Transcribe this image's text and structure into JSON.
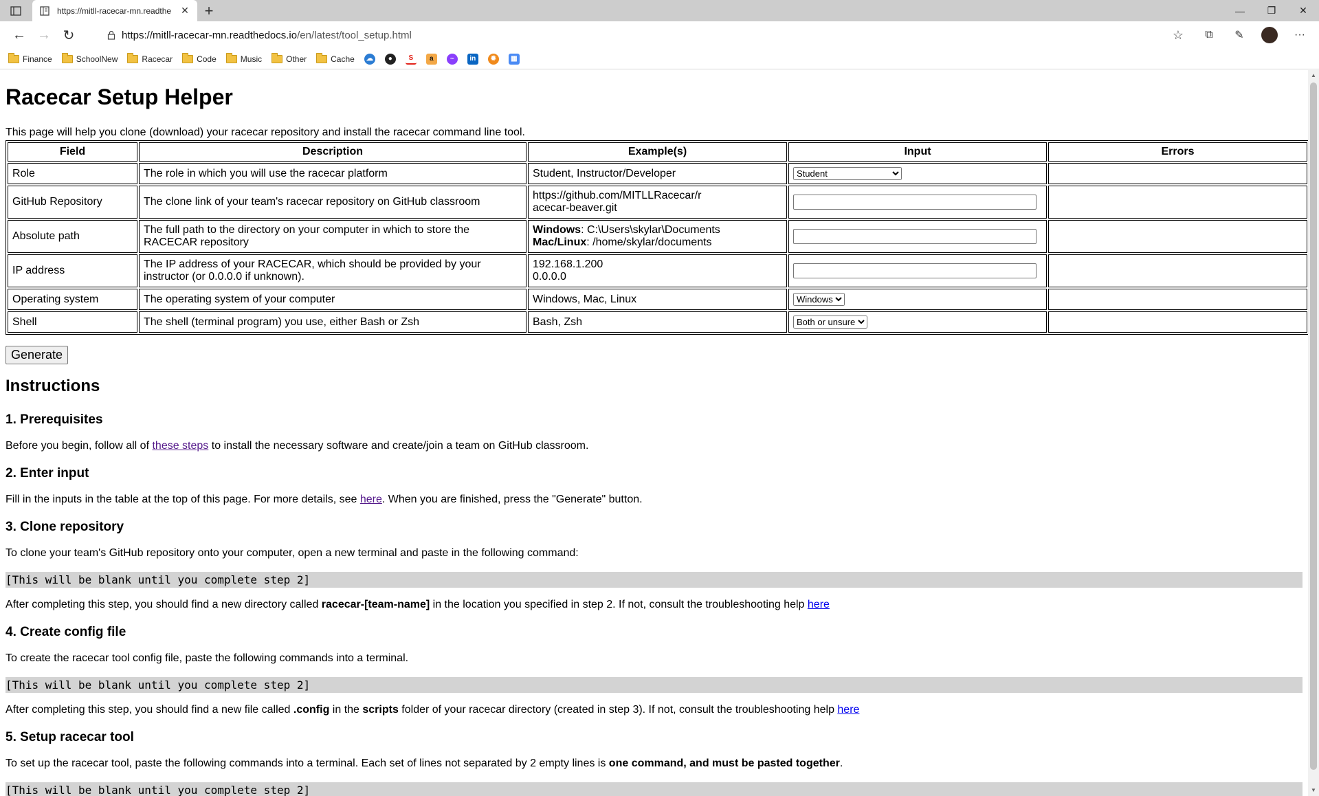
{
  "browser": {
    "tab_title": "https://mitll-racecar-mn.readthe",
    "url_host": "https://mitll-racecar-mn.readthedocs.io",
    "url_path": "/en/latest/tool_setup.html",
    "bookmarks": [
      "Finance",
      "SchoolNew",
      "Racecar",
      "Code",
      "Music",
      "Other",
      "Cache"
    ],
    "bookmark_icons": [
      "onedrive-icon",
      "github-icon",
      "stackoverflow-icon",
      "amazon-icon",
      "messenger-icon",
      "linkedin-icon",
      "sunburst-icon",
      "calendar-icon"
    ]
  },
  "page": {
    "title": "Racecar Setup Helper",
    "intro": "This page will help you clone (download) your racecar repository and install the racecar command line tool.",
    "table": {
      "headers": [
        "Field",
        "Description",
        "Example(s)",
        "Input",
        "Errors"
      ],
      "rows": [
        {
          "field": "Role",
          "description": "The role in which you will use the racecar platform",
          "example": "Student, Instructor/Developer",
          "input_type": "select",
          "selected": "Student"
        },
        {
          "field": "GitHub Repository",
          "description": "The clone link of your team's racecar repository on GitHub classroom",
          "example": "https://github.com/MITLLRacecar/racecar-beaver.git",
          "input_type": "text"
        },
        {
          "field": "Absolute path",
          "description": "The full path to the directory on your computer in which to store the RACECAR repository",
          "example_win_label": "Windows",
          "example_win": ": C:\\Users\\skylar\\Documents",
          "example_mac_label": "Mac/Linux",
          "example_mac": ": /home/skylar/documents",
          "input_type": "text"
        },
        {
          "field": "IP address",
          "description": "The IP address of your RACECAR, which should be provided by your instructor (or 0.0.0.0 if unknown).",
          "example_line1": "192.168.1.200",
          "example_line2": "0.0.0.0",
          "input_type": "text"
        },
        {
          "field": "Operating system",
          "description": "The operating system of your computer",
          "example": "Windows, Mac, Linux",
          "input_type": "select",
          "selected": "Windows"
        },
        {
          "field": "Shell",
          "description": "The shell (terminal program) you use, either Bash or Zsh",
          "example": "Bash, Zsh",
          "input_type": "select",
          "selected": "Both or unsure"
        }
      ]
    },
    "generate_label": "Generate",
    "instructions_title": "Instructions",
    "step1": {
      "title": "1. Prerequisites",
      "text_before": "Before you begin, follow all of ",
      "link": "these steps",
      "text_after": " to install the necessary software and create/join a team on GitHub classroom."
    },
    "step2": {
      "title": "2. Enter input",
      "text_before": "Fill in the inputs in the table at the top of this page. For more details, see ",
      "link": "here",
      "text_after": ". When you are finished, press the \"Generate\" button."
    },
    "step3": {
      "title": "3. Clone repository",
      "text": "To clone your team's GitHub repository onto your computer, open a new terminal and paste in the following command:",
      "code": "[This will be blank until you complete step 2]",
      "after_before": "After completing this step, you should find a new directory called ",
      "after_bold": "racecar-[team-name]",
      "after_mid": " in the location you specified in step 2. If not, consult the troubleshooting help ",
      "after_link": "here"
    },
    "step4": {
      "title": "4. Create config file",
      "text": "To create the racecar tool config file, paste the following commands into a terminal.",
      "code": "[This will be blank until you complete step 2]",
      "after_before": "After completing this step, you should find a new file called ",
      "after_bold1": ".config",
      "after_mid1": " in the ",
      "after_bold2": "scripts",
      "after_mid2": " folder of your racecar directory (created in step 3). If not, consult the troubleshooting help ",
      "after_link": "here"
    },
    "step5": {
      "title": "5. Setup racecar tool",
      "text_before": "To set up the racecar tool, paste the following commands into a terminal. Each set of lines not separated by 2 empty lines is ",
      "text_bold": "one command, and must be pasted together",
      "text_after": ".",
      "code": "[This will be blank until you complete step 2]"
    }
  }
}
